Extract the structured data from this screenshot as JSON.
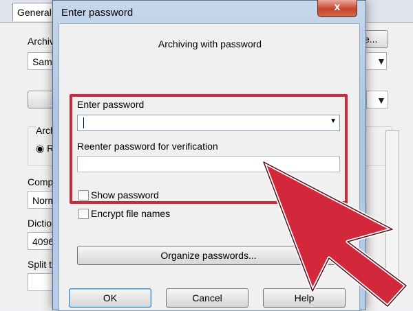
{
  "background_window": {
    "tab_general": "General",
    "label_archive": "Archiv",
    "archive_name_value": "Samp",
    "browse_button": "e...",
    "group_archive": "Arch",
    "label_compression": "Compr",
    "compression_value": "Norm",
    "label_dictionary": "Diction",
    "dictionary_value": "4096",
    "label_split": "Split t"
  },
  "dialog": {
    "title": "Enter password",
    "close_glyph": "x",
    "heading": "Archiving with password",
    "enter_password_label": "Enter password",
    "password_value": "",
    "reenter_label": "Reenter password for verification",
    "reenter_value": "",
    "show_password_label": "Show password",
    "show_password_checked": false,
    "encrypt_names_label": "Encrypt file names",
    "encrypt_names_checked": false,
    "organize_button": "Organize passwords...",
    "ok_button": "OK",
    "cancel_button": "Cancel",
    "help_button": "Help"
  },
  "annotation": {
    "highlight_color": "#d3283c",
    "cursor_color": "#d3283c"
  }
}
